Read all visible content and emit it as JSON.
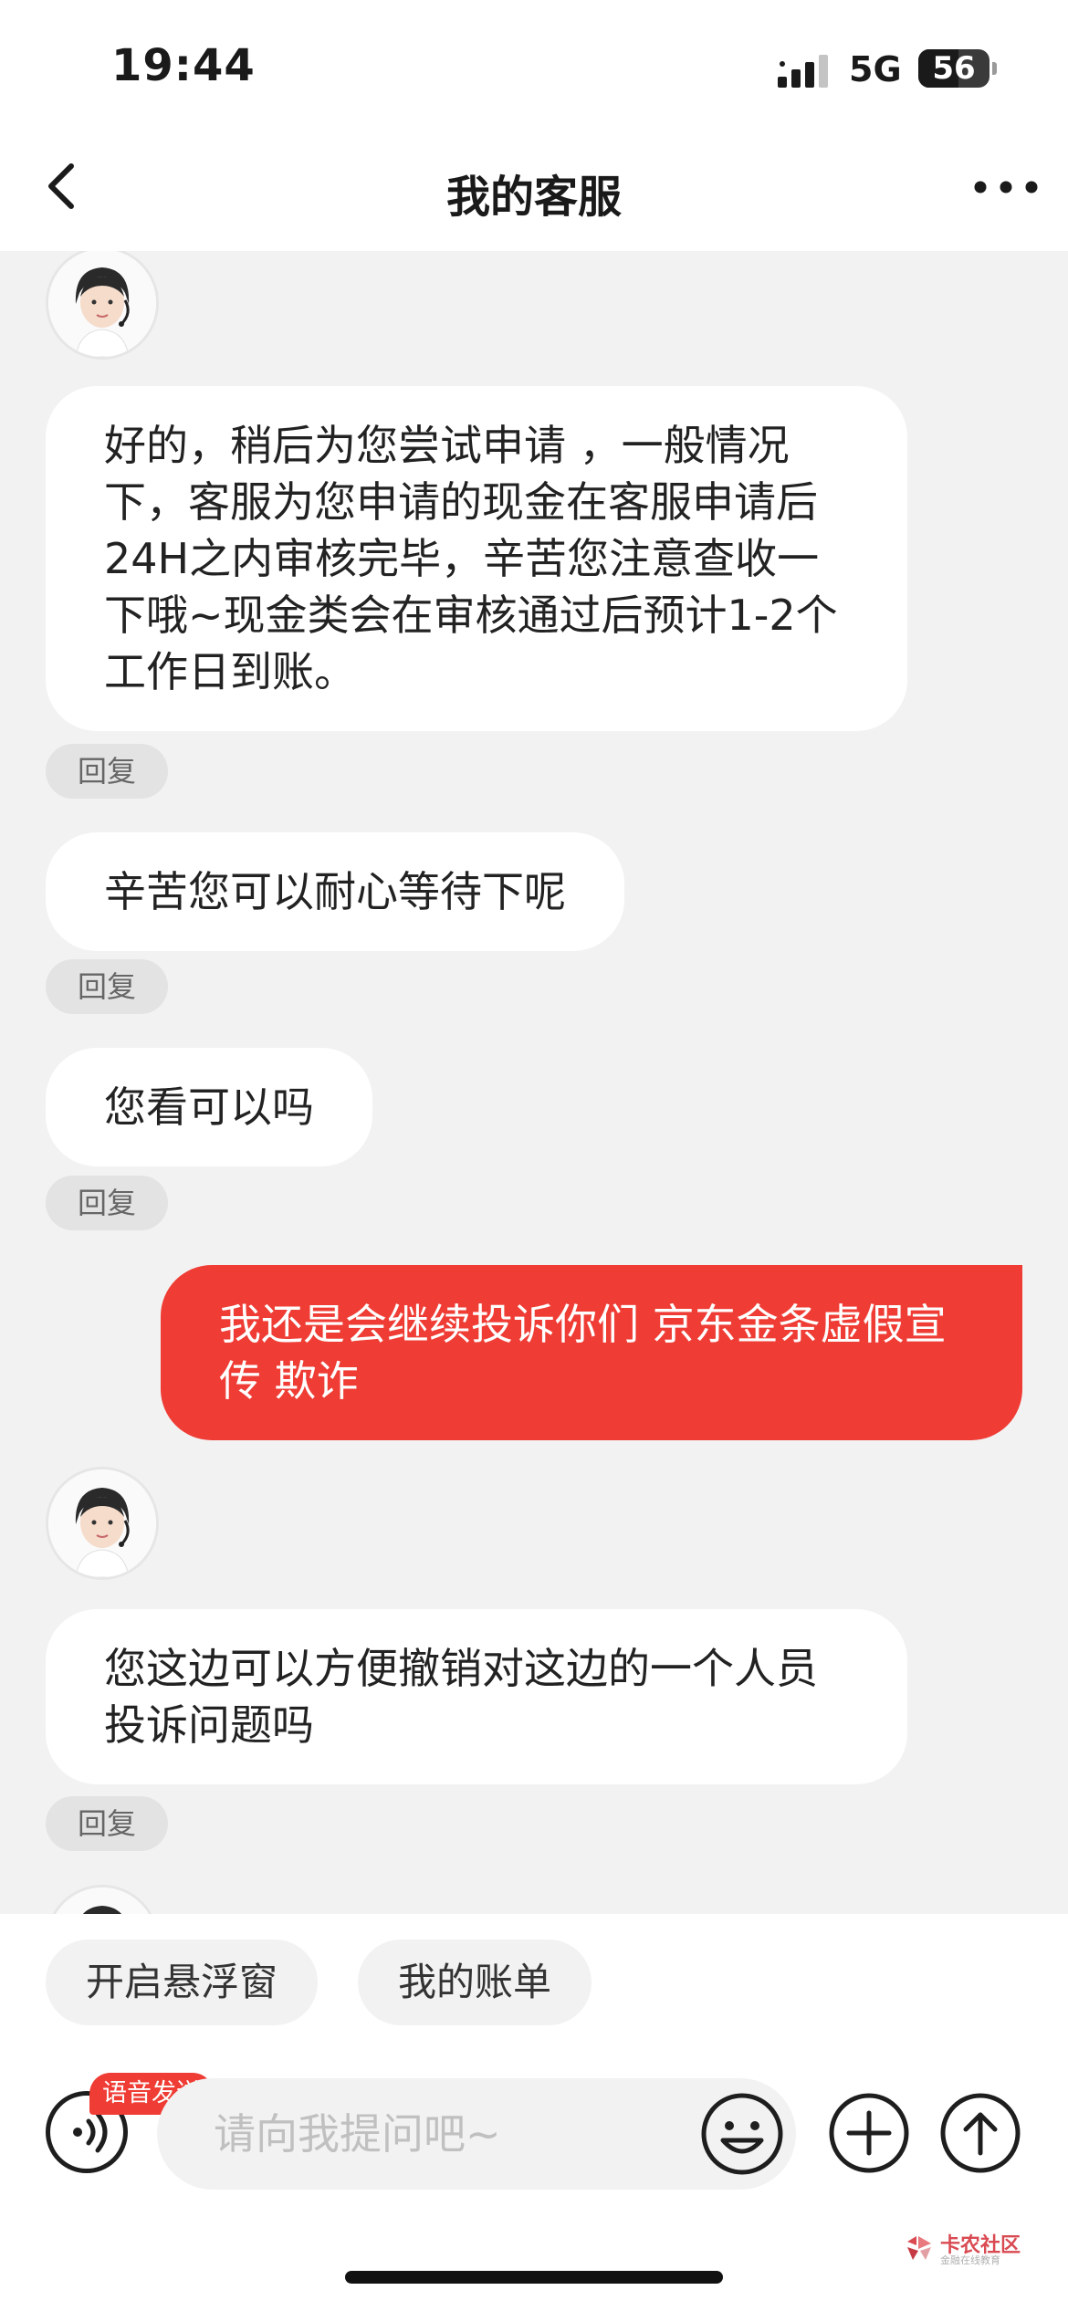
{
  "status_bar": {
    "time": "19:44",
    "network": "5G",
    "battery": "56",
    "battery_level": 0.56
  },
  "nav": {
    "title": "我的客服"
  },
  "messages": [
    {
      "from": "agent",
      "text": "好的，稍后为您尝试申请 ，一般情况下，客服为您申请的现金在客服申请后24H之内审核完毕，辛苦您注意查收一下哦~现金类会在审核通过后预计1-2个工作日到账。",
      "reply": "回复"
    },
    {
      "from": "agent",
      "text": "辛苦您可以耐心等待下呢",
      "reply": "回复"
    },
    {
      "from": "agent",
      "text": "您看可以吗",
      "reply": "回复"
    },
    {
      "from": "user",
      "text": "我还是会继续投诉你们 京东金条虚假宣传 欺诈"
    },
    {
      "from": "agent",
      "text": "您这边可以方便撤销对这边的一个人员投诉问题吗",
      "reply": "回复"
    }
  ],
  "quick_actions": [
    "开启悬浮窗",
    "我的账单"
  ],
  "input": {
    "placeholder": "请向我提问吧~",
    "value": ""
  },
  "voice_badge": "语音发送",
  "watermark": {
    "name": "卡农社区",
    "sub": "金融在线教育"
  },
  "colors": {
    "accent": "#ef3c34",
    "chat_bg": "#f2f2f2"
  },
  "icons": {
    "back": "chevron-left-icon",
    "more": "more-horizontal-icon",
    "signal": "signal-icon",
    "voice": "voice-wave-icon",
    "emoji": "smiley-icon",
    "plus": "plus-circle-icon",
    "send": "arrow-up-circle-icon"
  }
}
